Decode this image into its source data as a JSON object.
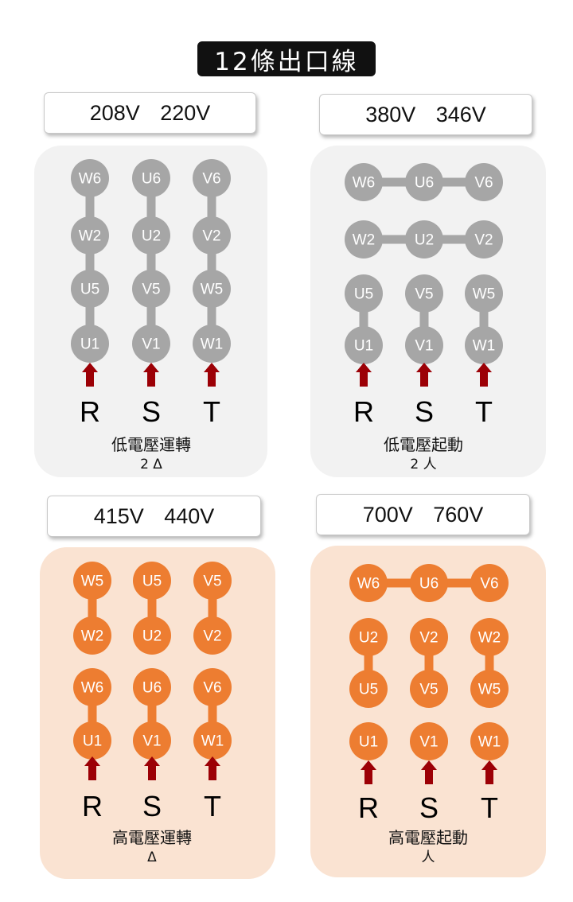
{
  "title": "12條出口線",
  "colors": {
    "gray_node": "#a6a6a6",
    "orange_node": "#ed7d31",
    "arrow": "#9c0006"
  },
  "phases": [
    "R",
    "S",
    "T"
  ],
  "panels": [
    {
      "id": "tl",
      "voltage": "208V 220V",
      "mode": "低電壓運轉",
      "config": "2 Δ",
      "theme": "gray",
      "columns": [
        [
          "W6",
          "W2",
          "U5",
          "U1"
        ],
        [
          "U6",
          "U2",
          "V5",
          "V1"
        ],
        [
          "V6",
          "V2",
          "W5",
          "W1"
        ]
      ],
      "connections": "all columns linked in series"
    },
    {
      "id": "tr",
      "voltage": "380V 346V",
      "mode": "低電壓起動",
      "config": "2 人",
      "theme": "gray",
      "rows": [
        [
          "W6",
          "U6",
          "V6"
        ],
        [
          "W2",
          "U2",
          "V2"
        ],
        [
          "U5",
          "V5",
          "W5"
        ],
        [
          "U1",
          "V1",
          "W1"
        ]
      ],
      "connections": "rows 1 and 2 linked horizontally; rows 3–4 linked per column"
    },
    {
      "id": "bl",
      "voltage": "415V 440V",
      "mode": "高電壓運轉",
      "config": "Δ",
      "theme": "orange",
      "columns": [
        [
          "W5",
          "W2",
          "W6",
          "U1"
        ],
        [
          "U5",
          "U2",
          "U6",
          "V1"
        ],
        [
          "V5",
          "V2",
          "V6",
          "W1"
        ]
      ],
      "connections": "pairs linked per column"
    },
    {
      "id": "br",
      "voltage": "700V 760V",
      "mode": "高電壓起動",
      "config": "人",
      "theme": "orange",
      "rows": [
        [
          "W6",
          "U6",
          "V6"
        ],
        [
          "U2",
          "V2",
          "W2"
        ],
        [
          "U5",
          "V5",
          "W5"
        ],
        [
          "U1",
          "V1",
          "W1"
        ]
      ],
      "connections": "row 1 linked horizontally; rows 2–3 linked per column"
    }
  ]
}
